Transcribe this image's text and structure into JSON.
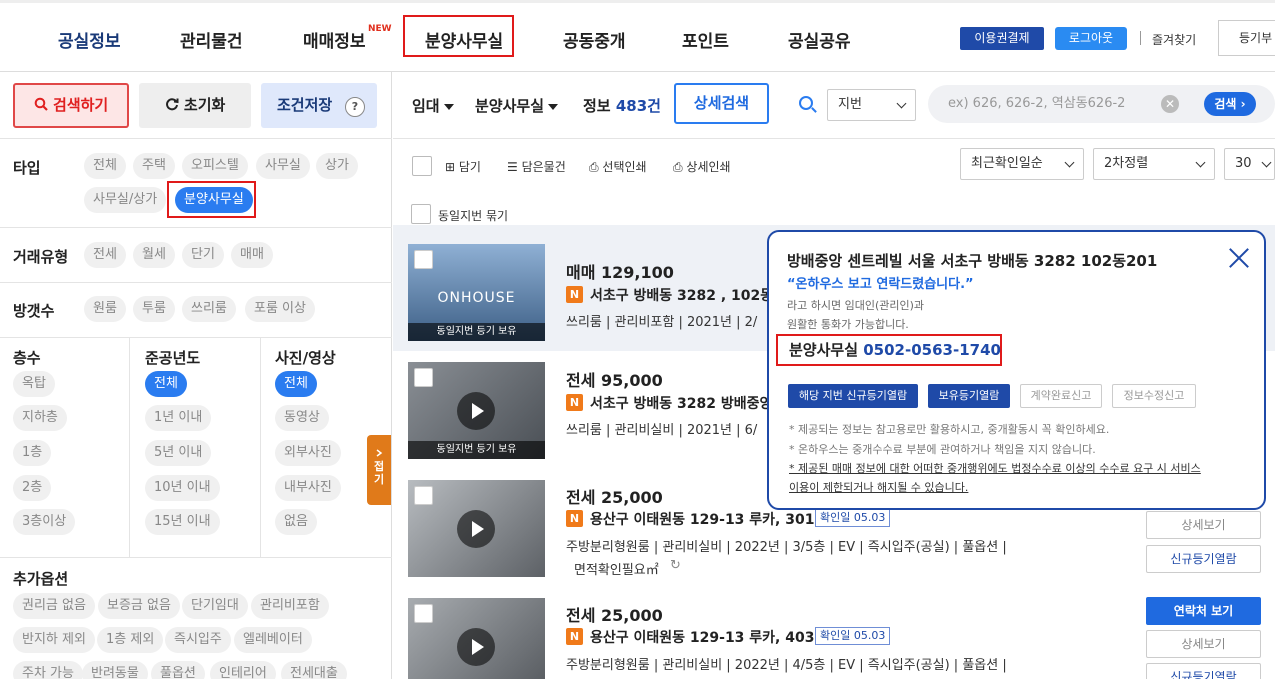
{
  "nav": {
    "items": [
      "공실정보",
      "관리물건",
      "매매정보",
      "분양사무실",
      "공동중개",
      "포인트",
      "공실공유"
    ],
    "new_badge": "NEW",
    "ticket": "이용권결제",
    "logout": "로그아웃",
    "favorites": "즐겨찾기",
    "register": "등기부"
  },
  "left": {
    "search": "검색하기",
    "reset": "초기화",
    "save": "조건저장",
    "help": "?",
    "type_label": "타입",
    "types": [
      "전체",
      "주택",
      "오피스텔",
      "사무실",
      "상가",
      "사무실/상가",
      "분양사무실"
    ],
    "deal_label": "거래유형",
    "deals": [
      "전세",
      "월세",
      "단기",
      "매매"
    ],
    "room_label": "방갯수",
    "rooms": [
      "원룸",
      "투룸",
      "쓰리룸",
      "포룸 이상"
    ],
    "floor_label": "층수",
    "floors": [
      "옥탑",
      "지하층",
      "1층",
      "2층",
      "3층이상"
    ],
    "year_label": "준공년도",
    "years": [
      "전체",
      "1년 이내",
      "5년 이내",
      "10년 이내",
      "15년 이내"
    ],
    "photo_label": "사진/영상",
    "photos": [
      "전체",
      "동영상",
      "외부사진",
      "내부사진",
      "없음"
    ],
    "extra_label": "추가옵션",
    "extras": [
      "권리금 없음",
      "보증금 없음",
      "단기임대",
      "관리비포함",
      "반지하 제외",
      "1층 제외",
      "즉시입주",
      "엘레베이터",
      "주차 가능",
      "반려동물",
      "풀옵션",
      "인테리어",
      "전세대출"
    ],
    "fold": "접기"
  },
  "main": {
    "sort1": "임대",
    "sort2": "분양사무실",
    "info": "정보",
    "count": "483건",
    "detail_search": "상세검색",
    "search_type": "지번",
    "search_placeholder": "ex) 626, 626-2, 역삼동626-2",
    "clear": "✕",
    "go": "검색",
    "tools": [
      "담기",
      "담은물건",
      "선택인쇄",
      "상세인쇄"
    ],
    "sort_recent": "최근확인일순",
    "sort_second": "2차정렬",
    "per_page": "30",
    "group_same": "동일지번 묶기"
  },
  "listings": [
    {
      "price": "매매 129,100",
      "addr": "서초구 방배동 3282 , 102동",
      "meta": "쓰리룸 | 관리비포함 | 2021년 | 2/",
      "thumb_logo": "ONHOUSE",
      "caption": "동일지번 등기 보유"
    },
    {
      "price": "전세 95,000",
      "addr": "서초구 방배동 3282 방배중앙",
      "meta": "쓰리룸 | 관리비실비 | 2021년 | 6/",
      "caption": "동일지번 등기 보유"
    },
    {
      "price": "전세 25,000",
      "addr": "용산구 이태원동 129-13 루카, 301",
      "date": "확인일 05.03",
      "meta": "주방분리형원룸 | 관리비실비 | 2022년 | 3/5층 | EV | 즉시입주(공실) | 풀옵션 |",
      "meta2": "면적확인필요㎡",
      "b1": "상세보기",
      "b2": "신규등기열람"
    },
    {
      "price": "전세 25,000",
      "addr": "용산구 이태원동 129-13 루카, 403",
      "date": "확인일 05.03",
      "meta": "주방분리형원룸 | 관리비실비 | 2022년 | 4/5층 | EV | 즉시입주(공실) | 풀옵션 |",
      "b0": "연락처 보기",
      "b1": "상세보기",
      "b2": "신규등기열람"
    }
  ],
  "popup": {
    "title": "방배중앙 센트레빌 서울 서초구 방배동 3282 102동201",
    "quote": "“온하우스 보고 연락드렸습니다.”",
    "sub1": "라고 하시면 임대인(관리인)과",
    "sub2": "원활한 통화가 가능합니다.",
    "phone_label": "분양사무실",
    "phone": "0502-0563-1740",
    "btns": [
      "해당 지번 신규등기열람",
      "보유등기열람",
      "계약완료신고",
      "정보수정신고"
    ],
    "note1": "* 제공되는 정보는 참고용로만 활용하시고, 중개활동시 꼭 확인하세요.",
    "note2": "* 온하우스는 중개수수료 부분에 관여하거나 책임을 지지 않습니다.",
    "note3": "* 제공된 매매 정보에 대한 어떠한 중개행위에도 법정수수료 이상의 수수료 요구 시 서비스",
    "note4": "이용이 제한되거나 해지될 수 있습니다."
  }
}
